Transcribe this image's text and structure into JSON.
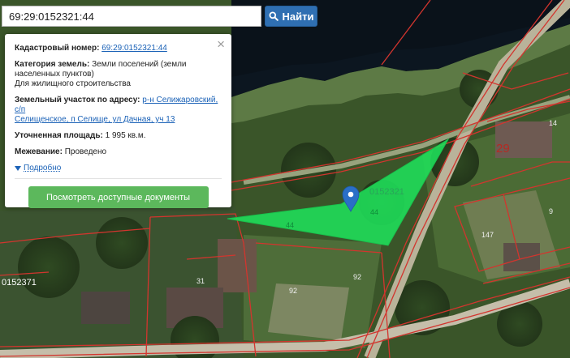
{
  "search": {
    "value": "69:29:0152321:44",
    "button_label": "Найти",
    "button_icon": "search-icon"
  },
  "popup": {
    "cadastral_label": "Кадастровый номер:",
    "cadastral_value": "69:29:0152321:44",
    "category_label": "Категория земель:",
    "category_value_line1": "Земли поселений (земли",
    "category_value_line2": "населенных пунктов)",
    "category_value_line3": "Для жилищного строительства",
    "address_label": "Земельный участок по адресу:",
    "address_value_line1": "р-н Селижаровский, с/п",
    "address_value_line2": "Селищенское, п Селище, ул Дачная, уч 13",
    "area_label": "Уточненная площадь:",
    "area_value": "1 995 кв.м.",
    "survey_label": "Межевание:",
    "survey_value": "Проведено",
    "more_label": "Подробно",
    "docs_button_label": "Посмотреть доступные документы"
  },
  "map": {
    "labels": {
      "quarter_number": "29",
      "quarter_code_right": "0152321",
      "quarter_code_left": "0152371",
      "parcel_14": "14",
      "parcel_9": "9",
      "parcel_147": "147",
      "parcel_31": "31",
      "parcel_92a": "92",
      "parcel_92b": "92",
      "parcel_44a": "44",
      "parcel_44b": "44"
    },
    "colors": {
      "highlight": "#1fe05a",
      "boundary": "#d2352e",
      "marker": "#2a6fc7",
      "water": "#0c1620",
      "vegetation": "#3d5a2b"
    }
  }
}
